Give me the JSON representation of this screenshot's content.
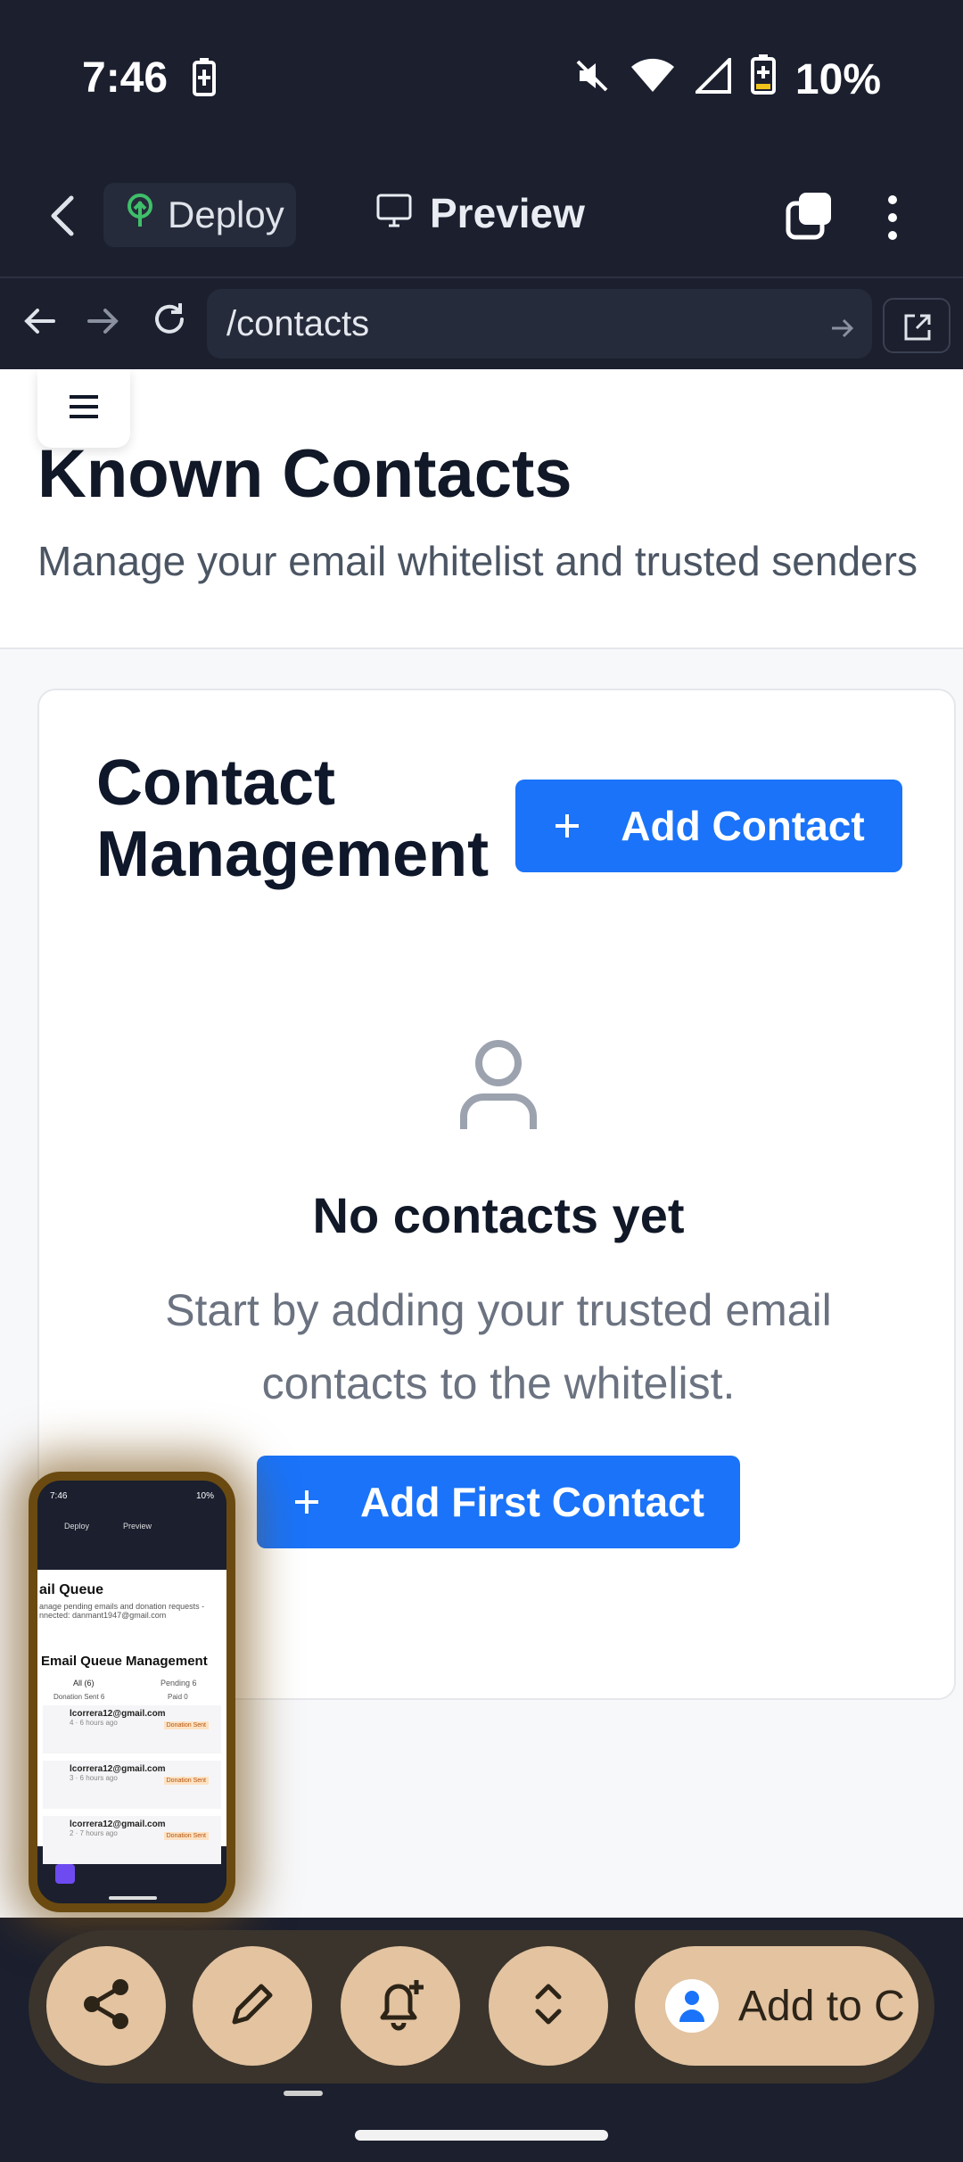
{
  "status_bar": {
    "time": "7:46",
    "battery": "10%"
  },
  "toolbar": {
    "deploy_label": "Deploy",
    "preview_label": "Preview"
  },
  "url_bar": {
    "path": "/contacts"
  },
  "page": {
    "title": "Known Contacts",
    "subtitle": "Manage your email whitelist and trusted senders",
    "card": {
      "title": "Contact Management",
      "add_contact_label": "Add Contact",
      "empty_title": "No contacts yet",
      "empty_text": "Start by adding your trusted email contacts to the whitelist.",
      "add_first_label": "Add First Contact"
    }
  },
  "pip": {
    "title": "ail Queue",
    "subtitle": "anage pending emails and donation requests - nnected: danmant1947@gmail.com",
    "heading": "Email Queue Management",
    "tabs": [
      "All (6)",
      "Pending 6"
    ],
    "filters": [
      "Donation Sent 6",
      "Paid 0"
    ],
    "rows": [
      {
        "email": "lcorrera12@gmail.com",
        "meta": "4 · 6 hours ago",
        "badge": "Donation Sent"
      },
      {
        "email": "lcorrera12@gmail.com",
        "meta": "3 · 6 hours ago",
        "badge": "Donation Sent"
      },
      {
        "email": "lcorrera12@gmail.com",
        "meta": "2 · 7 hours ago",
        "badge": "Donation Sent"
      }
    ]
  },
  "bubble_bar": {
    "add_to_label": "Add to C"
  },
  "colors": {
    "primary": "#1a73f8",
    "dark_bg": "#1b1f2e",
    "bubble": "#e3c3a0"
  }
}
